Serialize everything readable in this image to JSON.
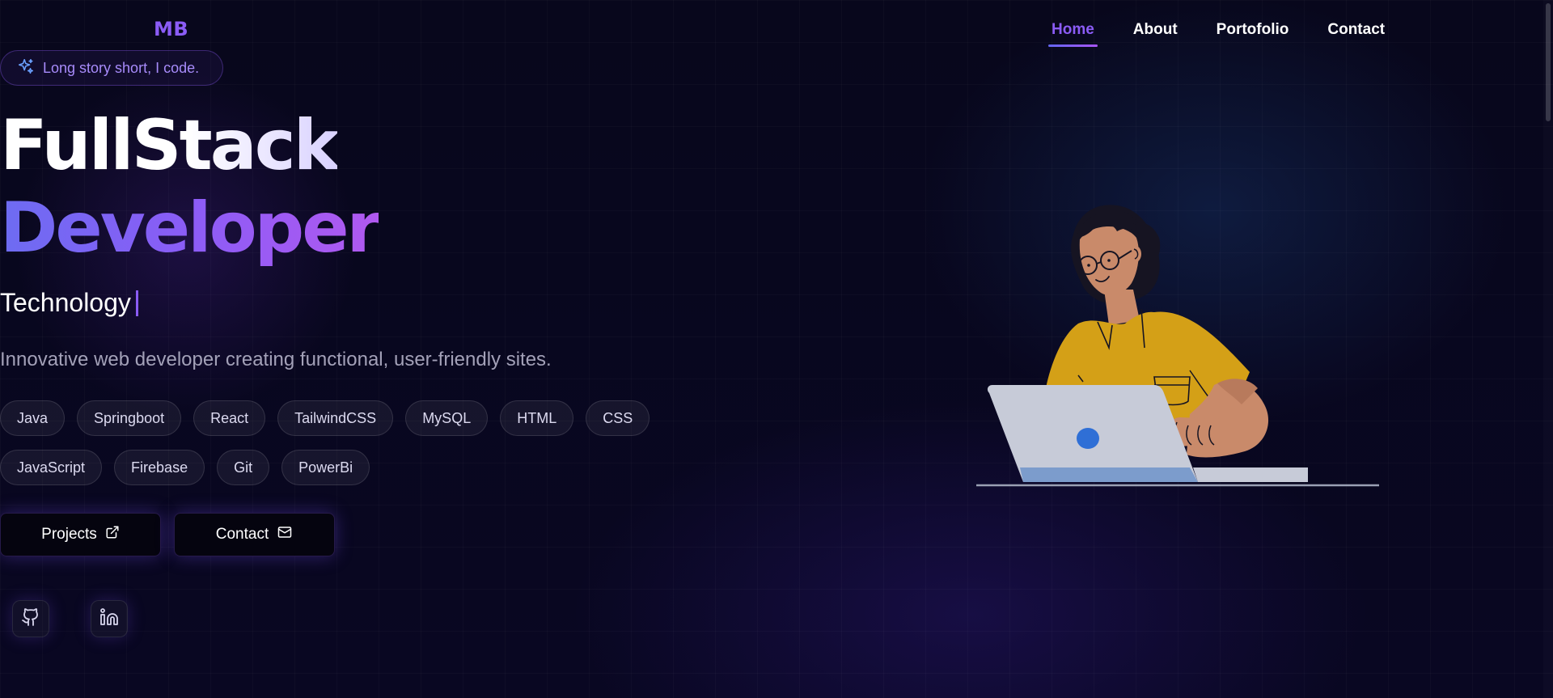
{
  "brand": {
    "logo": "MB"
  },
  "nav": {
    "items": [
      {
        "label": "Home",
        "active": true
      },
      {
        "label": "About",
        "active": false
      },
      {
        "label": "Portofolio",
        "active": false
      },
      {
        "label": "Contact",
        "active": false
      }
    ]
  },
  "hero": {
    "badge": {
      "icon": "sparkles-icon",
      "text": "Long story short, I code."
    },
    "title_line_1": "FullStack",
    "title_line_2": "Developer",
    "typed_text": "Technology",
    "tagline": "Innovative web developer creating functional, user-friendly sites.",
    "skills": [
      "Java",
      "Springboot",
      "React",
      "TailwindCSS",
      "MySQL",
      "HTML",
      "CSS",
      "JavaScript",
      "Firebase",
      "Git",
      "PowerBi"
    ],
    "buttons": {
      "projects": {
        "label": "Projects",
        "icon": "external-link-icon"
      },
      "contact": {
        "label": "Contact",
        "icon": "mail-icon"
      }
    },
    "social": [
      {
        "name": "github",
        "icon": "github-icon"
      },
      {
        "name": "linkedin",
        "icon": "linkedin-icon"
      }
    ]
  },
  "colors": {
    "accent": "#8b5cf6",
    "background": "#07061a",
    "shirt": "#d4a017",
    "laptop": "#c7cbd8"
  }
}
